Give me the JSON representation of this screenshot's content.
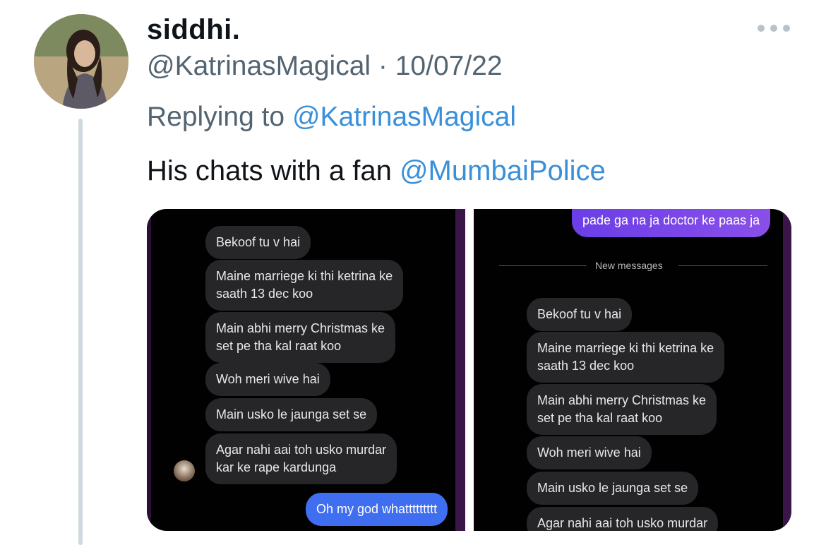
{
  "tweet": {
    "display_name": "siddhi.",
    "handle": "@KatrinasMagical",
    "separator": "·",
    "date": "10/07/22",
    "replying_prefix": "Replying to",
    "replying_to": "@KatrinasMagical",
    "text": "His chats with a fan",
    "text_mention": "@MumbaiPolice"
  },
  "media": {
    "left_panel": {
      "messages": [
        "Bekoof tu v hai",
        "Maine marriege ki thi ketrina ke",
        "saath 13 dec koo",
        "Main abhi merry Christmas ke",
        "set pe tha kal raat koo",
        "Woh meri wive hai",
        "Main usko le jaunga set se",
        "Agar nahi aai toh usko murdar",
        "kar ke rape kardunga"
      ],
      "sent": "Oh my god whattttttttt"
    },
    "right_panel": {
      "sent_top": "pade ga na ja doctor ke paas ja",
      "new_messages_label": "New messages",
      "messages": [
        "Bekoof tu v hai",
        "Maine marriege ki thi ketrina ke",
        "saath 13 dec koo",
        "Main abhi merry Christmas ke",
        "set pe tha kal raat koo",
        "Woh meri wive hai",
        "Main usko le jaunga set se",
        "Agar nahi aai toh usko murdar"
      ]
    }
  },
  "icons": [
    "avatar",
    "more-icon"
  ],
  "colors": {
    "mention": "#3a8fd9",
    "secondary_text": "#536471",
    "primary_text": "#0f1419",
    "sent_bubble": "#7a46e8",
    "sent_bubble_blue": "#3f6ef0"
  }
}
